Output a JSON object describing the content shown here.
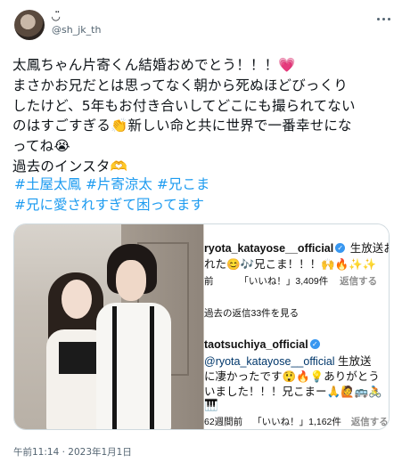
{
  "tweet": {
    "display_name": "◡̈",
    "handle": "@sh_jk_th",
    "lines": [
      "太鳳ちゃん片寄くん結婚おめでとう！！！💗",
      "まさかお兄だとは思ってなく朝から死ぬほどびっくり",
      "したけど、5年もお付き合いしてどこにも撮られてない",
      "のはすごすぎる👏新しい命と共に世界で一番幸せにな",
      "ってね😭",
      "過去のインスタ🫶"
    ],
    "hashtags_line1": [
      "#土屋太鳳",
      "#片寄涼太",
      "#兄こま"
    ],
    "hashtags_line2": [
      "#兄に愛されすぎて困ってます"
    ],
    "timestamp": "午前11:14 · 2023年1月1日"
  },
  "instagram": {
    "comment1_user": "ryota_katayose__official",
    "comment1_text_a": " 生放送お疲",
    "comment1_text_b": "れた😊🎶兄こま！！！🙌🔥✨✨",
    "comment1_meta_a": "前",
    "comment1_meta_likes": "「いいね！」3,409件",
    "comment1_meta_reply": "返信する",
    "view_replies": "過去の返信33件を見る",
    "comment2_user": "taotsuchiya_official",
    "comment2_mention": "@ryota_katayose__official",
    "comment2_text_a": " 生放送",
    "comment2_text_b": "に凄かったです😲🔥💡ありがとう",
    "comment2_text_c": "いました！！！兄こまー🙏🙋🚌🚴",
    "comment2_text_d": "🎹",
    "comment2_meta_a": "62週間前",
    "comment2_meta_likes": "「いいね！」1,162件",
    "comment2_meta_reply": "返信する"
  },
  "icons": {
    "more": "more-horizontal-icon",
    "verified": "verified-badge-icon"
  },
  "colors": {
    "link": "#1d9bf0",
    "text": "#0f1419",
    "secondary": "#536471",
    "border": "#cfd9de"
  }
}
